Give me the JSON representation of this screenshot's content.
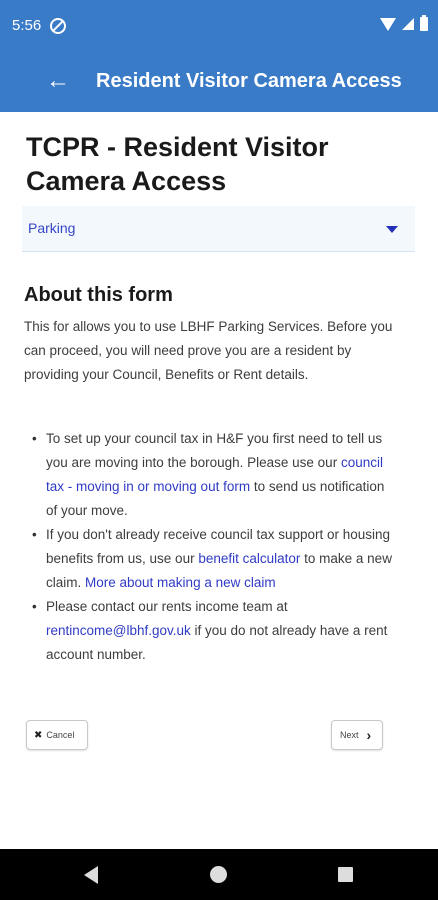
{
  "status_bar": {
    "time": "5:56"
  },
  "app_bar": {
    "title": "Resident Visitor Camera Access"
  },
  "page": {
    "title": "TCPR - Resident Visitor Camera Access"
  },
  "dropdown": {
    "selected": "Parking"
  },
  "about": {
    "heading": "About this form",
    "intro": "This for allows you to use LBHF Parking Services. Before you can proceed, you will need prove you are a resident by providing your Council, Benefits or Rent details."
  },
  "bullets": [
    {
      "pre": "To set up your council tax in H&F you first need to tell us you are moving into the borough. Please use our ",
      "link": "council tax - moving in or moving out form",
      "post": " to send us notification of your move."
    },
    {
      "pre": "If you don't already receive council tax support or housing benefits from us, use our ",
      "link": "benefit calculator",
      "mid": " to make a new claim. ",
      "link2": "More about making a new claim"
    },
    {
      "pre": "Please contact our rents income team at ",
      "link": "rentincome@lbhf.gov.uk",
      "post": " if you do not already have a rent account number."
    }
  ],
  "buttons": {
    "cancel": "Cancel",
    "next": "Next"
  },
  "icons": {
    "back": "arrow-left-icon",
    "caret": "caret-down-icon",
    "cancel": "close-icon",
    "next": "chevron-right-icon"
  },
  "colors": {
    "header": "#3a7bc8",
    "link": "#2f3bc5",
    "dropdown_bg": "#f3f8fd"
  }
}
